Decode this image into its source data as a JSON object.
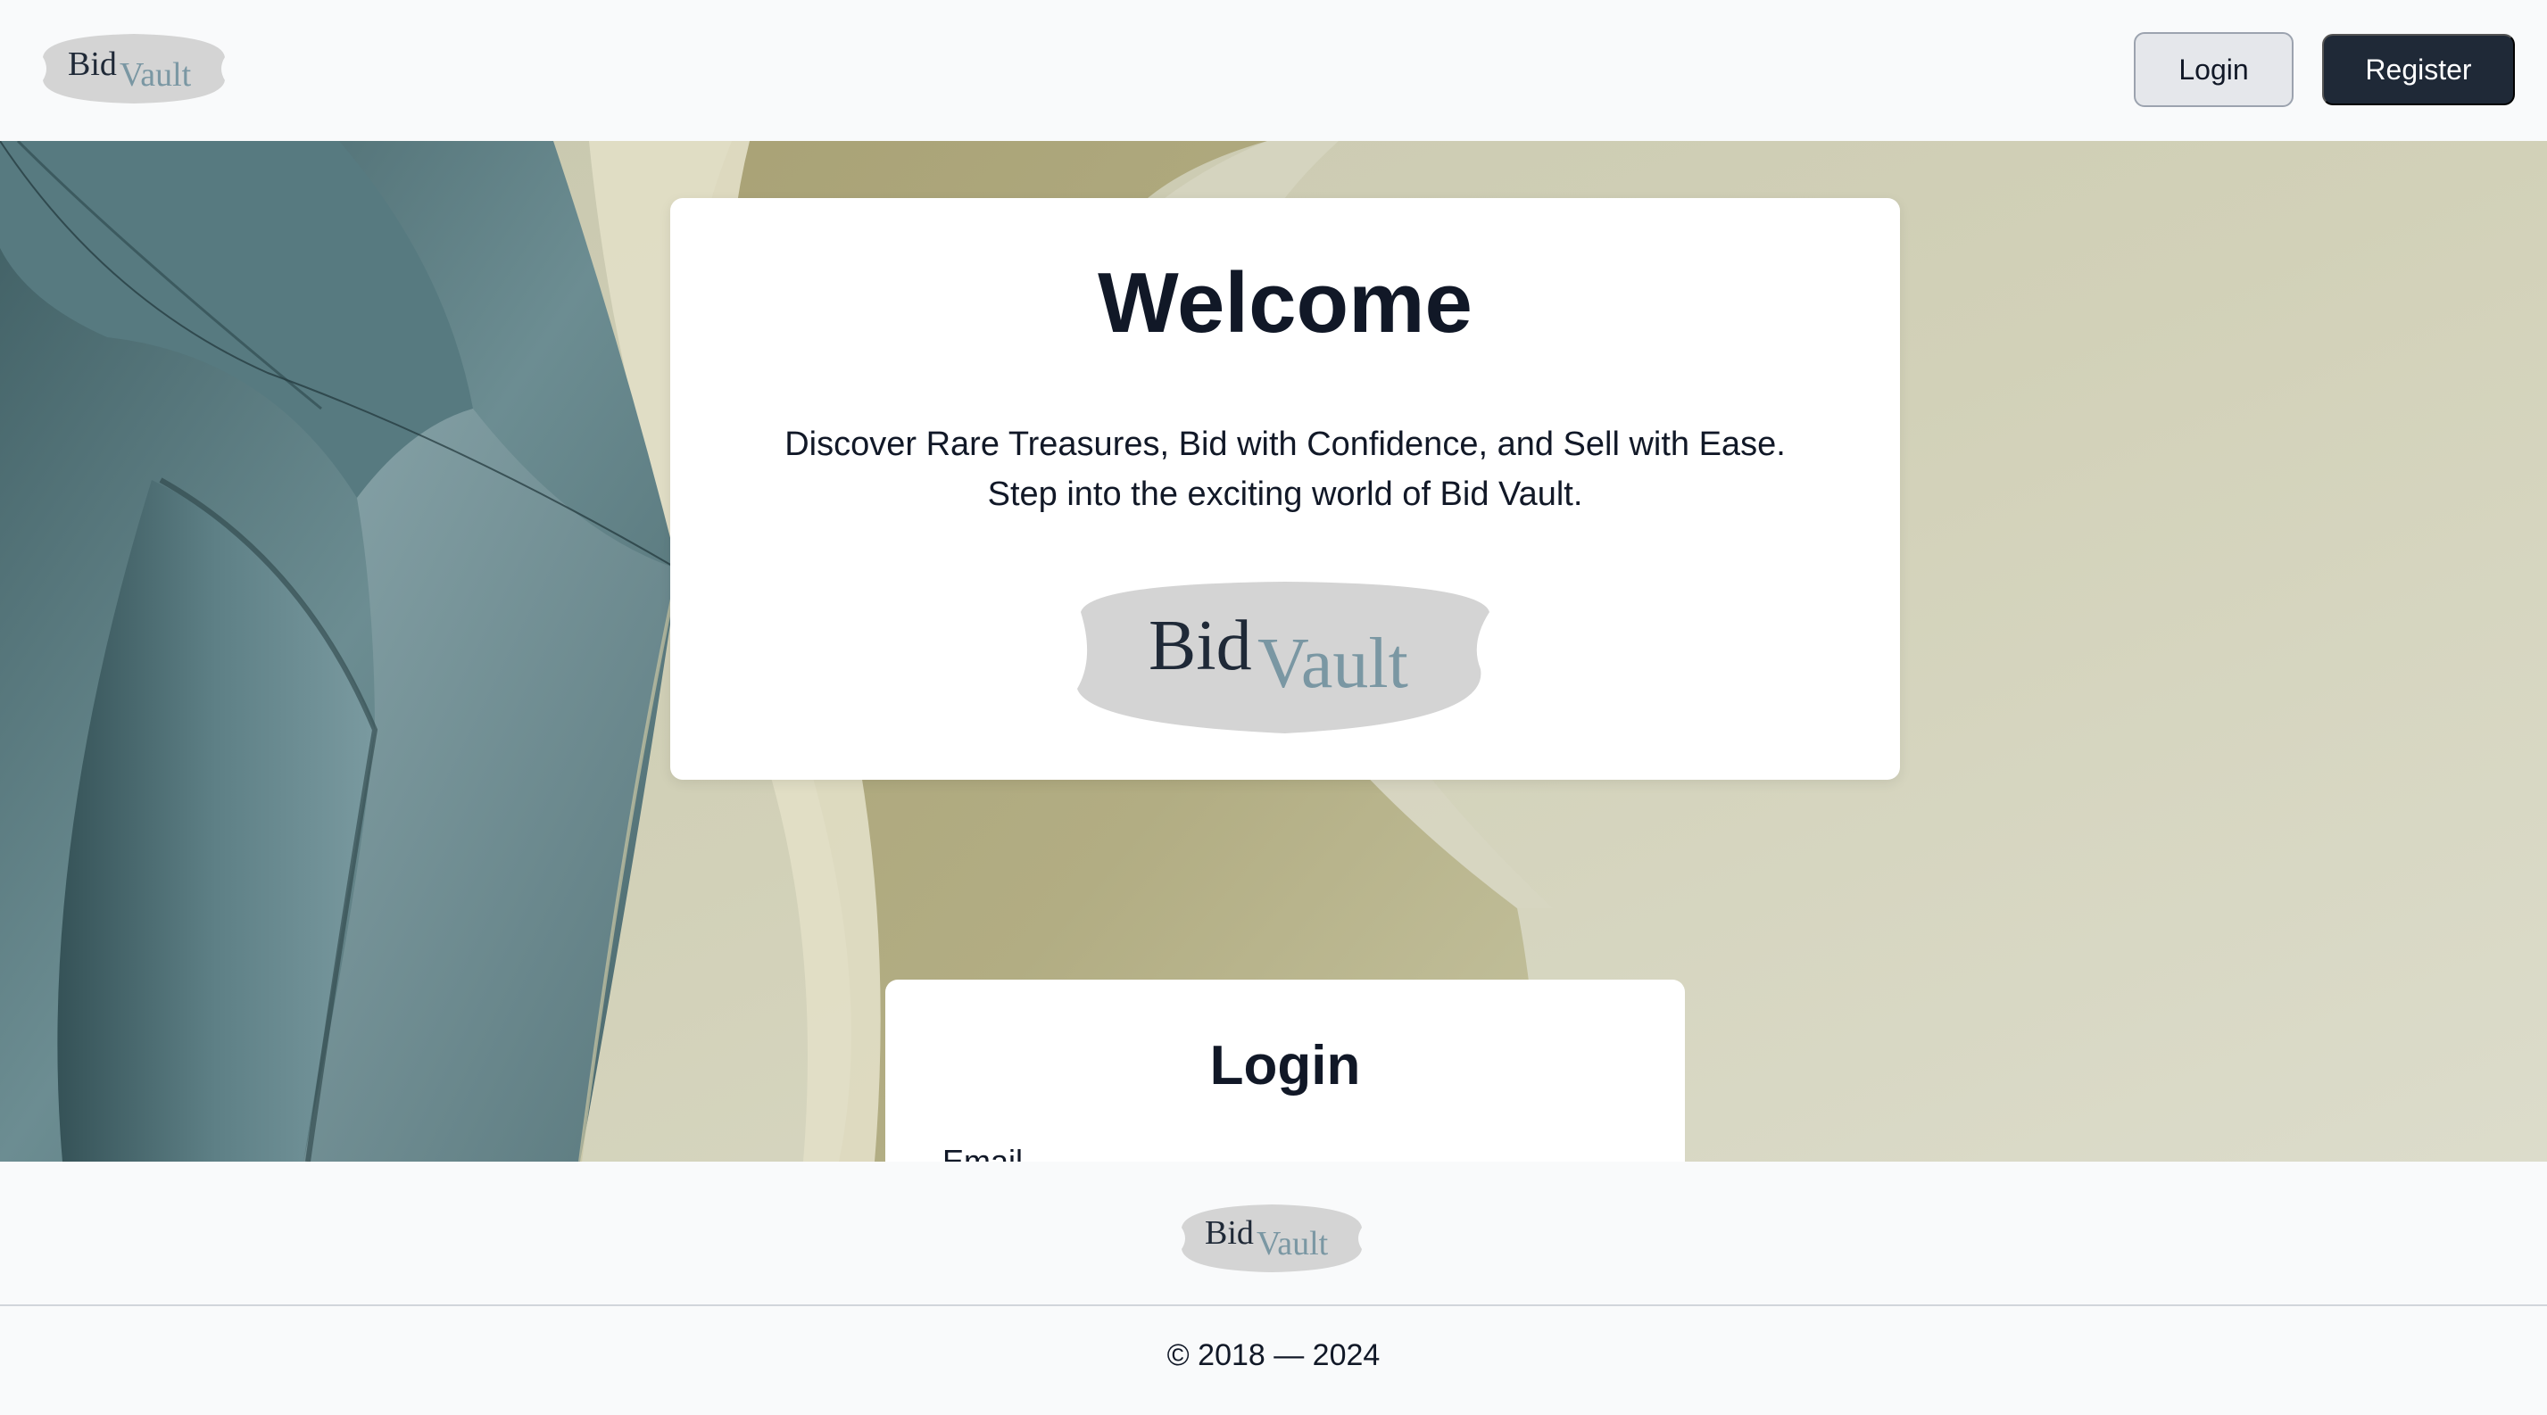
{
  "header": {
    "logo": {
      "part1": "Bid",
      "part2": "Vault"
    },
    "login_label": "Login",
    "register_label": "Register"
  },
  "welcome": {
    "title": "Welcome",
    "line1": "Discover Rare Treasures, Bid with Confidence, and Sell with Ease.",
    "line2": "Step into the exciting world of Bid Vault.",
    "logo": {
      "part1": "Bid",
      "part2": "Vault"
    }
  },
  "login_form": {
    "title": "Login",
    "email_label": "Email"
  },
  "footer": {
    "logo": {
      "part1": "Bid",
      "part2": "Vault"
    },
    "copyright": "© 2018 — 2024"
  },
  "colors": {
    "primary_dark": "#1f2937",
    "logo_dark": "#1f2937",
    "logo_accent": "#7a97a3",
    "logo_blob": "#d4d4d4",
    "hero_sage": "#5d7e85",
    "hero_olive": "#a9a475"
  },
  "icons": {
    "logo": "bidvault-logo"
  }
}
